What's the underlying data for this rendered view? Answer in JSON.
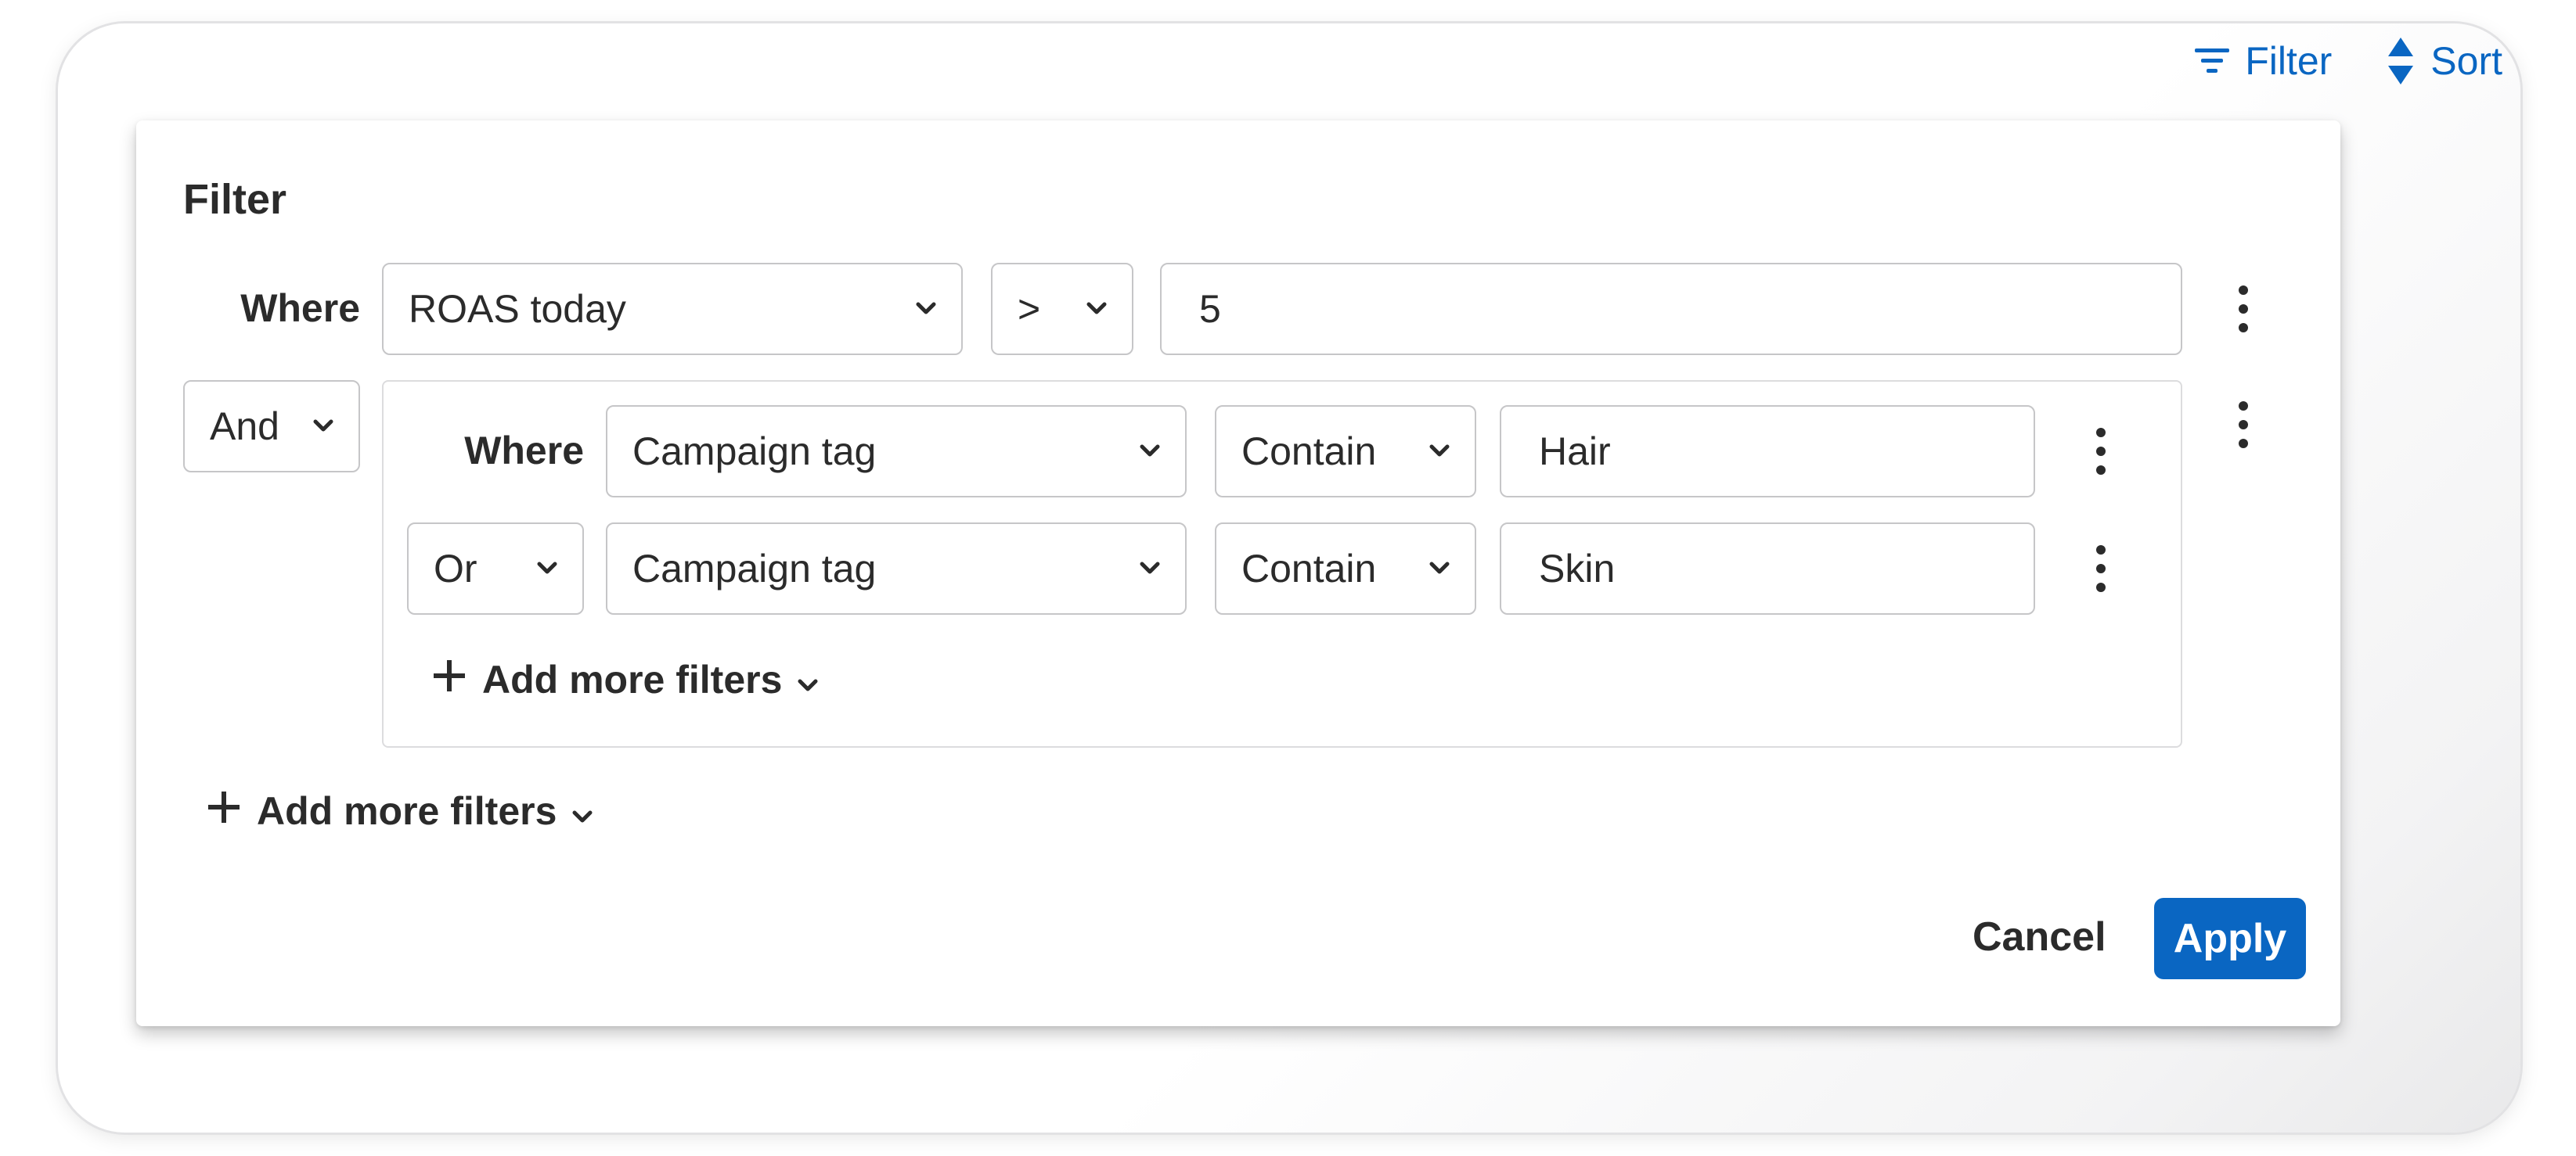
{
  "toolbar": {
    "filter_label": "Filter",
    "sort_label": "Sort"
  },
  "filter_panel": {
    "title": "Filter",
    "first_row": {
      "label": "Where",
      "field": "ROAS today",
      "operator": ">",
      "value": "5"
    },
    "group_conjunction": "And",
    "group": {
      "row1": {
        "label": "Where",
        "field": "Campaign tag",
        "operator": "Contain",
        "value": "Hair"
      },
      "row2": {
        "conjunction": "Or",
        "field": "Campaign tag",
        "operator": "Contain",
        "value": "Skin"
      },
      "add_more_label": "Add more filters"
    },
    "add_more_label": "Add more filters",
    "cancel_label": "Cancel",
    "apply_label": "Apply"
  },
  "colors": {
    "accent": "#0a66c2",
    "text": "#2b2b2b",
    "border": "#c6c6c8"
  }
}
